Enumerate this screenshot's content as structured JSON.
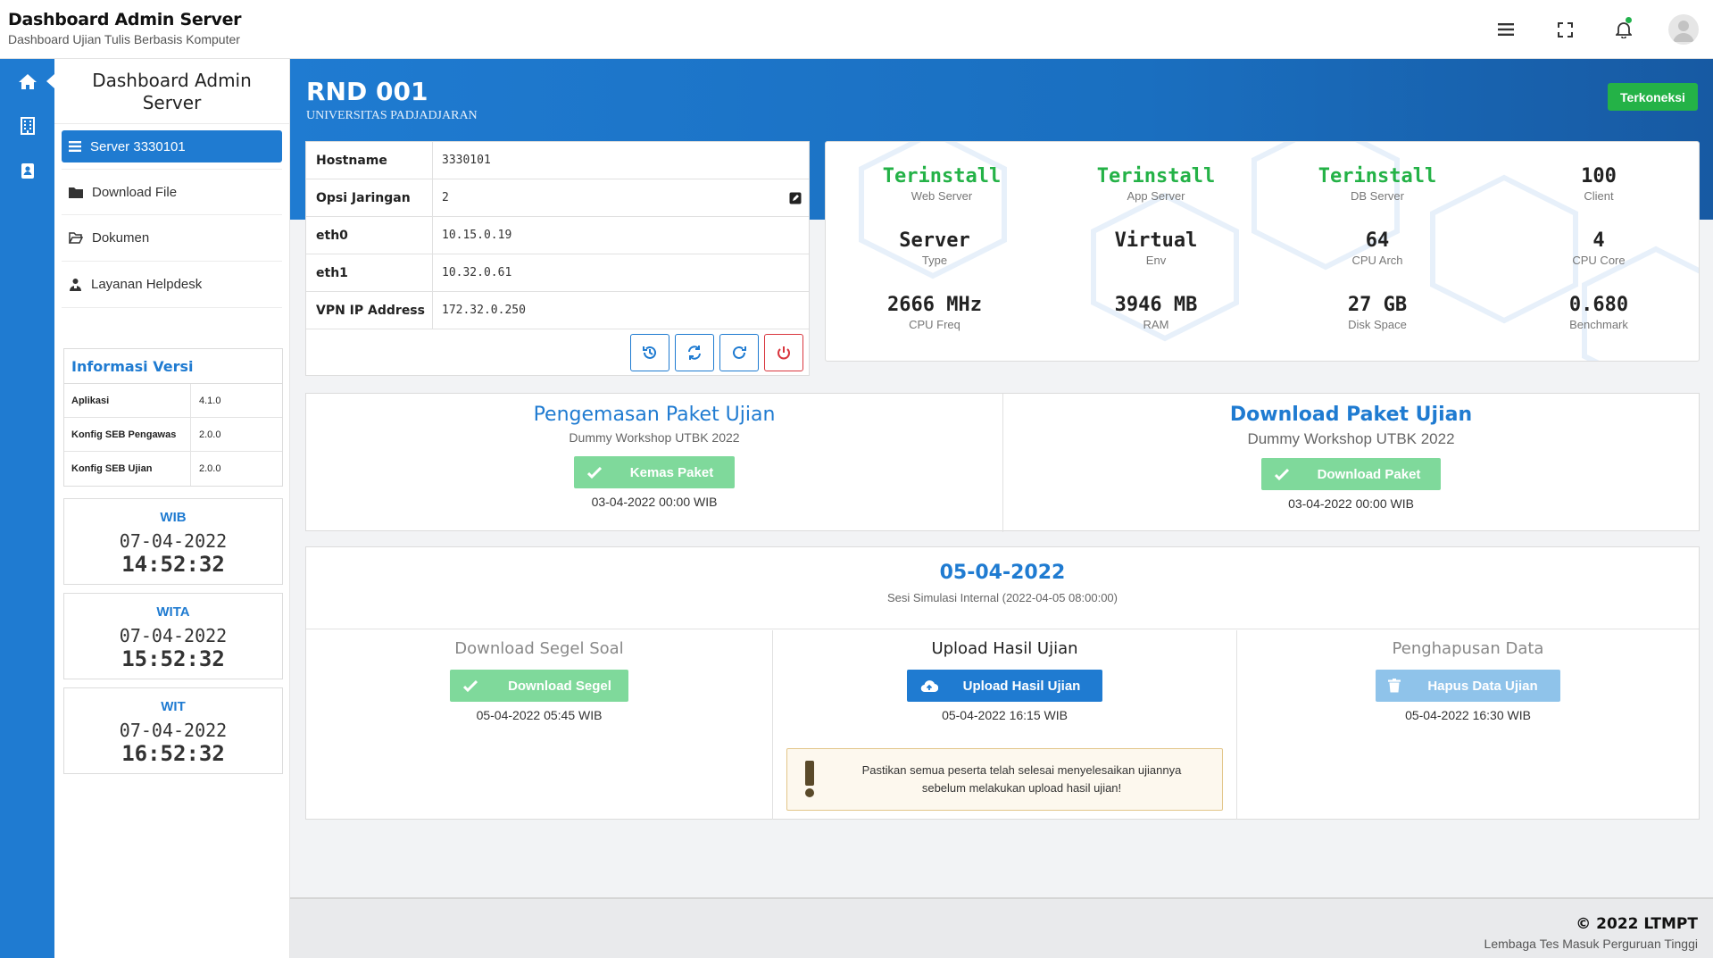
{
  "header": {
    "title": "Dashboard Admin Server",
    "subtitle": "Dashboard Ujian Tulis Berbasis Komputer",
    "icons": [
      "menu-icon",
      "fullscreen-icon",
      "bell-icon",
      "user-avatar-icon"
    ]
  },
  "sidebar": {
    "title": "Dashboard Admin Server",
    "items": [
      {
        "label": "Server 3330101",
        "icon": "server-icon",
        "active": true
      },
      {
        "label": "Download File",
        "icon": "folder-icon"
      },
      {
        "label": "Dokumen",
        "icon": "folder-open-icon"
      },
      {
        "label": "Layanan Helpdesk",
        "icon": "helpdesk-icon"
      }
    ],
    "version": {
      "title": "Informasi Versi",
      "rows": [
        {
          "key": "Aplikasi",
          "value": "4.1.0"
        },
        {
          "key": "Konfig SEB Pengawas",
          "value": "2.0.0"
        },
        {
          "key": "Konfig SEB Ujian",
          "value": "2.0.0"
        }
      ]
    },
    "clocks": [
      {
        "zone": "WIB",
        "date": "07-04-2022",
        "time": "14:52:32"
      },
      {
        "zone": "WITA",
        "date": "07-04-2022",
        "time": "15:52:32"
      },
      {
        "zone": "WIT",
        "date": "07-04-2022",
        "time": "16:52:32"
      }
    ]
  },
  "main": {
    "title": "RND 001",
    "subtitle": "UNIVERSITAS PADJADJARAN",
    "status_badge": "Terkoneksi",
    "host": [
      {
        "key": "Hostname",
        "value": "3330101"
      },
      {
        "key": "Opsi Jaringan",
        "value": "2"
      },
      {
        "key": "eth0",
        "value": "10.15.0.19"
      },
      {
        "key": "eth1",
        "value": "10.32.0.61"
      },
      {
        "key": "VPN IP Address",
        "value": "172.32.0.250"
      }
    ],
    "stats": [
      {
        "value": "Terinstall",
        "label": "Web Server"
      },
      {
        "value": "Terinstall",
        "label": "App Server"
      },
      {
        "value": "Terinstall",
        "label": "DB Server"
      },
      {
        "value": "100",
        "label": "Client"
      },
      {
        "value": "Server",
        "label": "Type"
      },
      {
        "value": "Virtual",
        "label": "Env"
      },
      {
        "value": "64",
        "label": "CPU Arch"
      },
      {
        "value": "4",
        "label": "CPU Core"
      },
      {
        "value": "2666 MHz",
        "label": "CPU Freq"
      },
      {
        "value": "3946 MB",
        "label": "RAM"
      },
      {
        "value": "27 GB",
        "label": "Disk Space"
      },
      {
        "value": "0.680",
        "label": "Benchmark"
      }
    ],
    "packing": {
      "title": "Pengemasan Paket Ujian",
      "subtitle": "Dummy Workshop UTBK 2022",
      "button": "Kemas Paket",
      "stamp": "03-04-2022 00:00 WIB"
    },
    "download": {
      "title": "Download Paket Ujian",
      "subtitle": "Dummy Workshop UTBK 2022",
      "button": "Download Paket",
      "stamp": "03-04-2022 00:00 WIB"
    },
    "session": {
      "date": "05-04-2022",
      "desc": "Sesi Simulasi Internal (2022-04-05 08:00:00)",
      "seal": {
        "title": "Download Segel Soal",
        "button": "Download Segel",
        "stamp": "05-04-2022 05:45 WIB"
      },
      "upload": {
        "title": "Upload Hasil Ujian",
        "button": "Upload Hasil Ujian",
        "stamp": "05-04-2022 16:15 WIB",
        "warning_line1": "Pastikan semua peserta telah selesai menyelesaikan ujiannya",
        "warning_line2": "sebelum melakukan upload hasil ujian!"
      },
      "delete": {
        "title": "Penghapusan Data",
        "button": "Hapus Data Ujian",
        "stamp": "05-04-2022 16:30 WIB"
      }
    }
  },
  "footer": {
    "copyright": "© 2022 LTMPT",
    "org": "Lembaga Tes Masuk Perguruan Tinggi"
  },
  "colors": {
    "primary": "#1f7bd1",
    "success": "#24b247",
    "success_light": "#7fd99b",
    "danger": "#d9363e"
  }
}
